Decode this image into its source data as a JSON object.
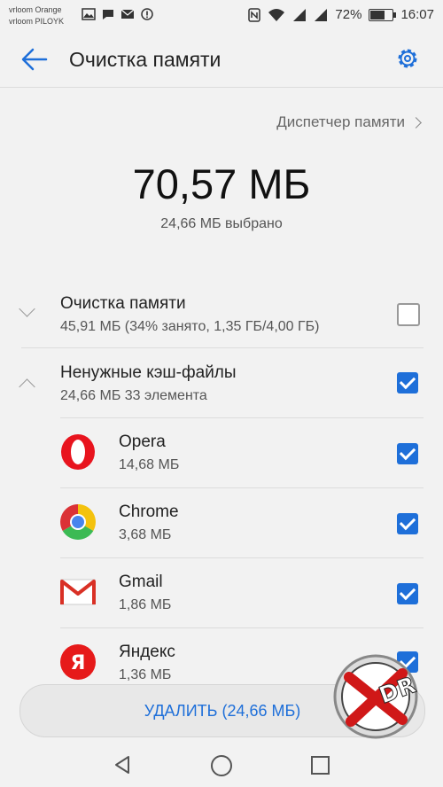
{
  "status_bar": {
    "carriers": [
      "vrloom Orange",
      "vrloom PILOYK"
    ],
    "battery": "72%",
    "time": "16:07",
    "battery_fraction": 0.72
  },
  "header": {
    "title": "Очистка памяти"
  },
  "memory_manager_link": "Диспетчер памяти",
  "summary": {
    "total": "70,57 МБ",
    "selected": "24,66 МБ выбрано"
  },
  "sections": [
    {
      "title": "Очистка памяти",
      "subtitle": "45,91 МБ (34% занято, 1,35 ГБ/4,00 ГБ)",
      "checked": false,
      "expanded": false
    },
    {
      "title": "Ненужные кэш-файлы",
      "subtitle": "24,66 МБ  33 элемента",
      "checked": true,
      "expanded": true
    }
  ],
  "apps": [
    {
      "name": "Opera",
      "size": "14,68 МБ",
      "icon": "opera-icon",
      "checked": true
    },
    {
      "name": "Chrome",
      "size": "3,68 МБ",
      "icon": "chrome-icon",
      "checked": true
    },
    {
      "name": "Gmail",
      "size": "1,86 МБ",
      "icon": "gmail-icon",
      "checked": true
    },
    {
      "name": "Яндекс",
      "size": "1,36 МБ",
      "icon": "yandex-icon",
      "checked": true
    }
  ],
  "delete_button": "УДАЛИТЬ (24,66 МБ)",
  "colors": {
    "accent": "#1e6fd9",
    "opera": "#e8141e",
    "yandex": "#e61a1a",
    "gmail": "#d93025"
  }
}
